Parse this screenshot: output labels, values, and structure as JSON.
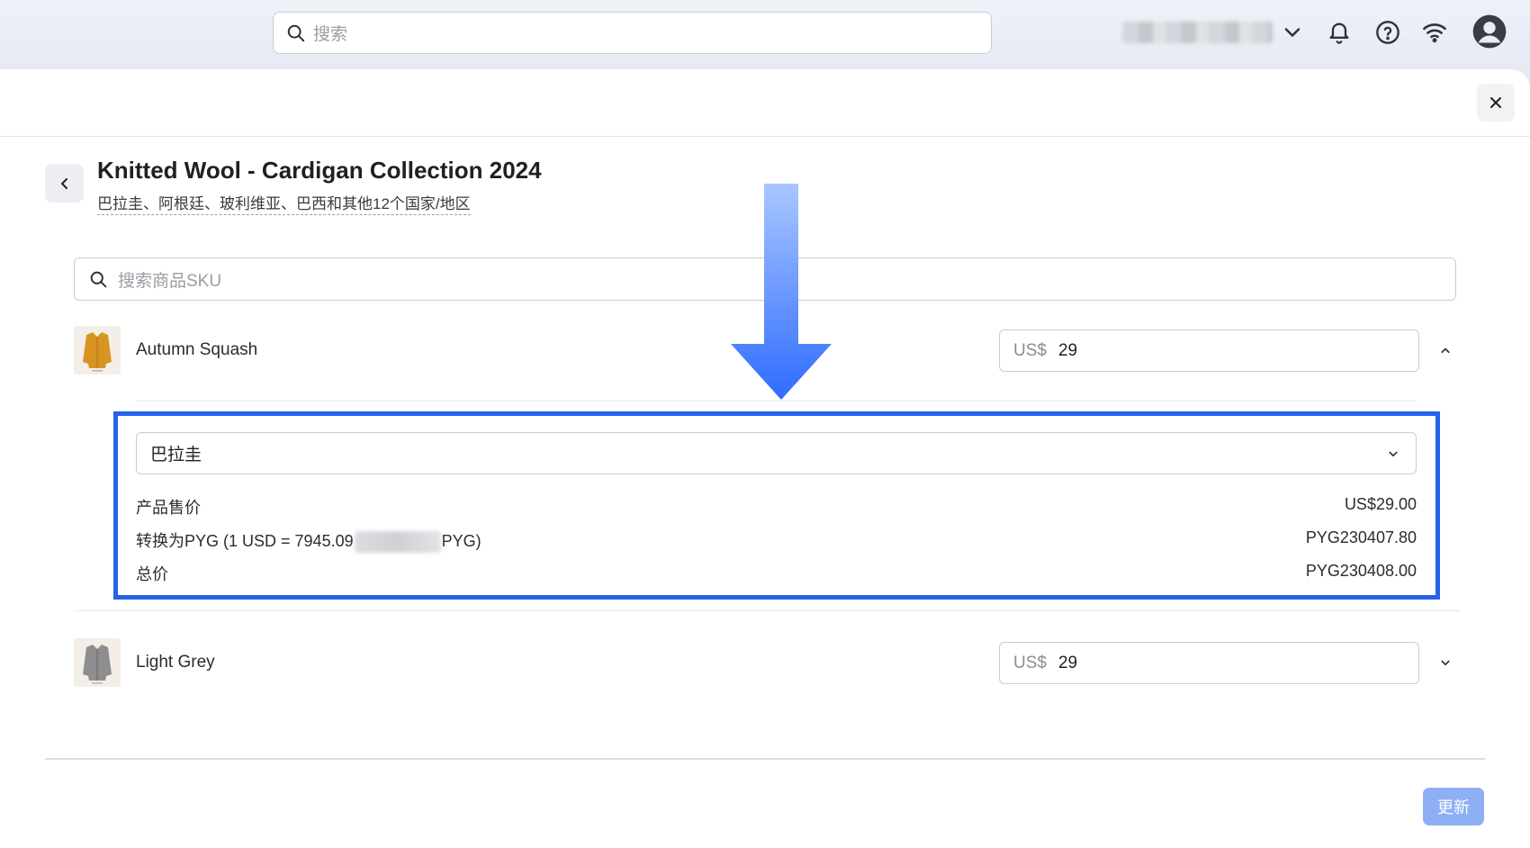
{
  "topbar": {
    "search_placeholder": "搜索",
    "icons": [
      "search-icon",
      "chevron-down-icon",
      "bell-icon",
      "help-icon",
      "wifi-icon",
      "user-avatar-icon"
    ]
  },
  "panel": {
    "title": "Knitted Wool - Cardigan Collection 2024",
    "subtitle": "巴拉圭、阿根廷、玻利维亚、巴西和其他12个国家/地区",
    "sku_search_placeholder": "搜索商品SKU",
    "update_label": "更新"
  },
  "products": [
    {
      "name": "Autumn Squash",
      "currency": "US$",
      "price": "29",
      "expanded": true,
      "swatch_color": "#d89422"
    },
    {
      "name": "Light Grey",
      "currency": "US$",
      "price": "29",
      "expanded": false,
      "swatch_color": "#8e8e8e"
    }
  ],
  "details": {
    "country": "巴拉圭",
    "rows": [
      {
        "label": "产品售价",
        "amount": "US$29.00"
      },
      {
        "label_prefix": "转换为PYG (1 USD = 7945.09",
        "label_suffix": "PYG)",
        "amount": "PYG230407.80"
      },
      {
        "label": "总价",
        "amount": "PYG230408.00"
      }
    ]
  },
  "colors": {
    "highlight": "#2563eb",
    "arrow": "#3b74ff",
    "button": "#8eaff3"
  }
}
